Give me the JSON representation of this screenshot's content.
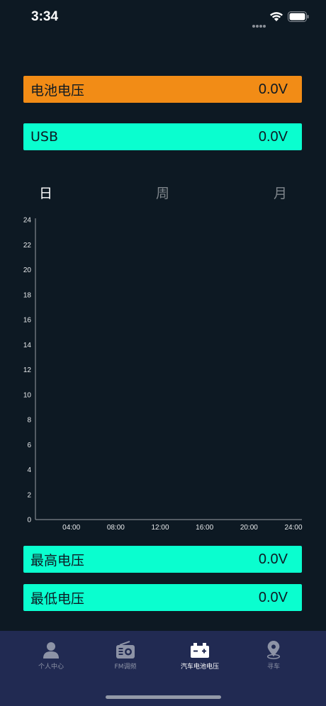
{
  "status_bar": {
    "time": "3:34"
  },
  "battery_voltage": {
    "label": "电池电压",
    "value": "0.0V"
  },
  "usb_voltage": {
    "label": "USB",
    "value": "0.0V"
  },
  "period_tabs": [
    {
      "label": "日",
      "active": true
    },
    {
      "label": "周",
      "active": false
    },
    {
      "label": "月",
      "active": false
    }
  ],
  "chart_data": {
    "type": "line",
    "y_ticks": [
      "0",
      "2",
      "4",
      "6",
      "8",
      "10",
      "12",
      "14",
      "16",
      "18",
      "20",
      "22",
      "24"
    ],
    "x_ticks": [
      "04:00",
      "08:00",
      "12:00",
      "16:00",
      "20:00",
      "24:00"
    ],
    "ylim": [
      0,
      24
    ],
    "series": [],
    "grid": false
  },
  "max_voltage": {
    "label": "最高电压",
    "value": "0.0V"
  },
  "min_voltage": {
    "label": "最低电压",
    "value": "0.0V"
  },
  "tabbar": [
    {
      "label": "个人中心",
      "icon": "person-icon",
      "active": false
    },
    {
      "label": "FM调频",
      "icon": "radio-icon",
      "active": false
    },
    {
      "label": "汽车电池电压",
      "icon": "car-battery-icon",
      "active": true
    },
    {
      "label": "寻车",
      "icon": "location-pin-icon",
      "active": false
    }
  ],
  "colors": {
    "background": "#0d1923",
    "battery_bar": "#f28c16",
    "teal_bar": "#0afecf",
    "tabbar_bg": "#212a52"
  }
}
